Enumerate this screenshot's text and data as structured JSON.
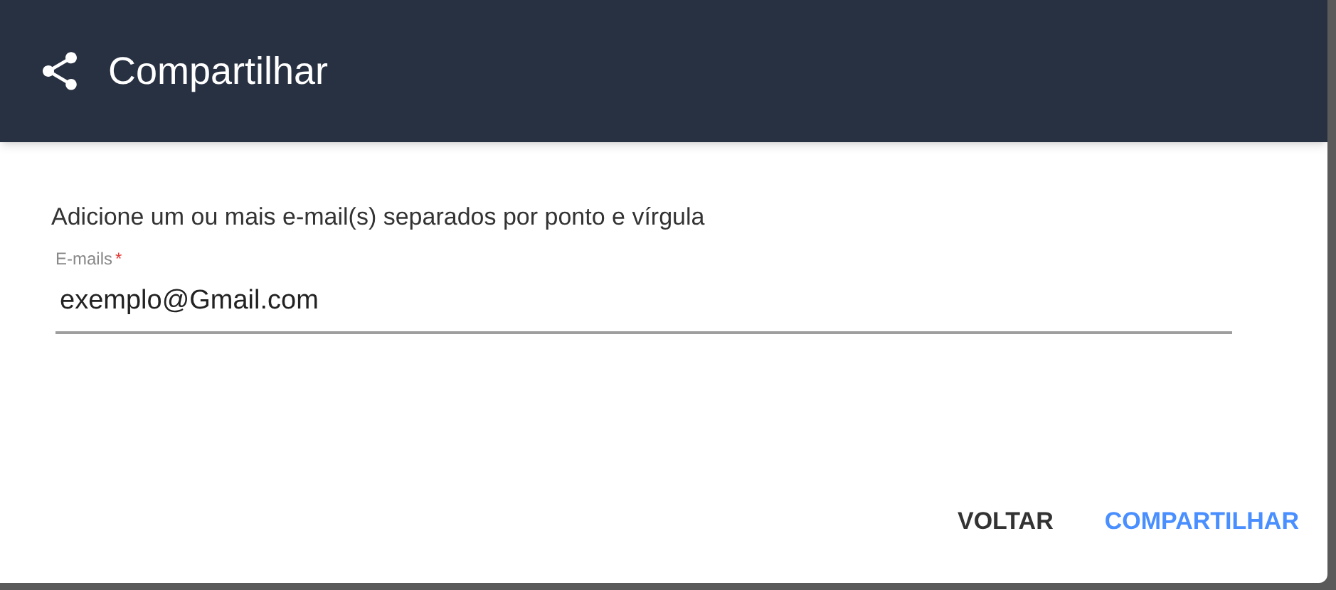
{
  "dialog": {
    "title": "Compartilhar"
  },
  "instructions": "Adicione um ou mais e-mail(s) separados por ponto e vírgula",
  "email_field": {
    "label": "E-mails",
    "required": true,
    "required_mark": "*",
    "value": "exemplo@Gmail.com"
  },
  "buttons": [
    {
      "label": "VOLTAR",
      "kind": "default"
    },
    {
      "label": "COMPARTILHAR",
      "kind": "primary"
    }
  ]
}
